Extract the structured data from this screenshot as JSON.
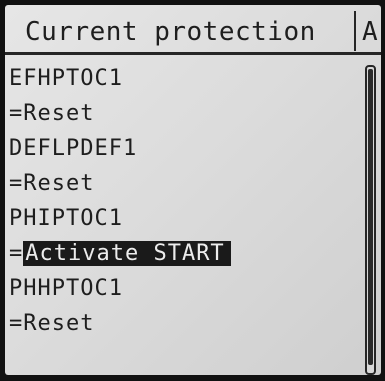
{
  "header": {
    "title": "Current protection",
    "overflow_text": "A"
  },
  "menu": {
    "items": [
      {
        "prefix": "",
        "value": "EFHPTOC1",
        "selected": false
      },
      {
        "prefix": "=",
        "value": "Reset",
        "selected": false
      },
      {
        "prefix": "",
        "value": "DEFLPDEF1",
        "selected": false
      },
      {
        "prefix": "=",
        "value": "Reset",
        "selected": false
      },
      {
        "prefix": "",
        "value": "PHIPTOC1",
        "selected": false
      },
      {
        "prefix": "=",
        "value": "Activate START",
        "selected": true
      },
      {
        "prefix": "",
        "value": "PHHPTOC1",
        "selected": false
      },
      {
        "prefix": "=",
        "value": "Reset",
        "selected": false
      }
    ]
  },
  "scrollbar": {
    "position": 0,
    "visible_fraction": 0.97
  },
  "colors": {
    "screen_background": "#dcdcdc",
    "text": "#1e1e1e",
    "selection_background": "#1a1a1a",
    "selection_text": "#ececec",
    "bezel": "#111111"
  }
}
